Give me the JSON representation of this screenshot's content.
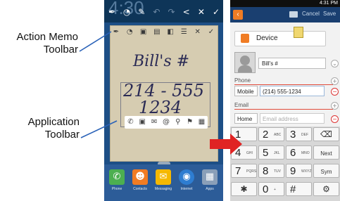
{
  "labels": {
    "action_memo_toolbar": [
      "Action Memo",
      "Toolbar"
    ],
    "application_toolbar": [
      "Application",
      "Toolbar"
    ]
  },
  "left_phone": {
    "clock": "4:30",
    "top_icons": [
      "pen-icon",
      "lasso-icon",
      "pencil-icon",
      "undo-icon",
      "redo-icon",
      "share-icon",
      "close-icon",
      "check-icon"
    ],
    "memo_toolbar_icons": [
      "pen-icon",
      "lasso-icon",
      "image-icon",
      "memo-icon",
      "settings-icon",
      "list-icon",
      "close-icon",
      "check-icon"
    ],
    "memo_title": "Bill's #",
    "memo_number_line1": "214 - 555",
    "memo_number_line2": "1234",
    "app_toolbar_icons": [
      "phone-icon",
      "contacts-icon",
      "email-icon",
      "internet-icon",
      "search-icon",
      "map-icon",
      "more-icon"
    ],
    "dock": [
      {
        "label": "Phone",
        "icon": "phone-icon",
        "color": "#4caf50"
      },
      {
        "label": "Contacts",
        "icon": "contacts-icon",
        "color": "#f07c24"
      },
      {
        "label": "Messaging",
        "icon": "messaging-icon",
        "color": "#f5b800"
      },
      {
        "label": "Internet",
        "icon": "internet-icon",
        "color": "#2e7dd1"
      },
      {
        "label": "Apps",
        "icon": "apps-icon",
        "color": "#8a9fb8"
      }
    ]
  },
  "right_phone": {
    "status_time": "4:31 PM",
    "actions": [
      "Cancel",
      "Save"
    ],
    "account": "Device",
    "name": "Bill's #",
    "phone_section": "Phone",
    "phone_type": "Mobile",
    "phone_value": "(214) 555-1234",
    "email_section": "Email",
    "email_type": "Home",
    "email_placeholder": "Email address",
    "keys": [
      {
        "main": "1",
        "sub": ""
      },
      {
        "main": "2",
        "sub": "ABC"
      },
      {
        "main": "3",
        "sub": "DEF"
      },
      {
        "main": "⌫",
        "sub": ""
      },
      {
        "main": "4",
        "sub": "GHI"
      },
      {
        "main": "5",
        "sub": "JKL"
      },
      {
        "main": "6",
        "sub": "MNO"
      },
      {
        "main": "Next",
        "sub": ""
      },
      {
        "main": "7",
        "sub": "PQRS"
      },
      {
        "main": "8",
        "sub": "TUV"
      },
      {
        "main": "9",
        "sub": "WXYZ"
      },
      {
        "main": "Sym",
        "sub": ""
      },
      {
        "main": "✱",
        "sub": ""
      },
      {
        "main": "0",
        "sub": "+"
      },
      {
        "main": "#",
        "sub": ""
      },
      {
        "main": "⚙",
        "sub": ""
      }
    ]
  },
  "colors": {
    "callout_line": "#2a62b8",
    "arrow": "#e02424"
  }
}
